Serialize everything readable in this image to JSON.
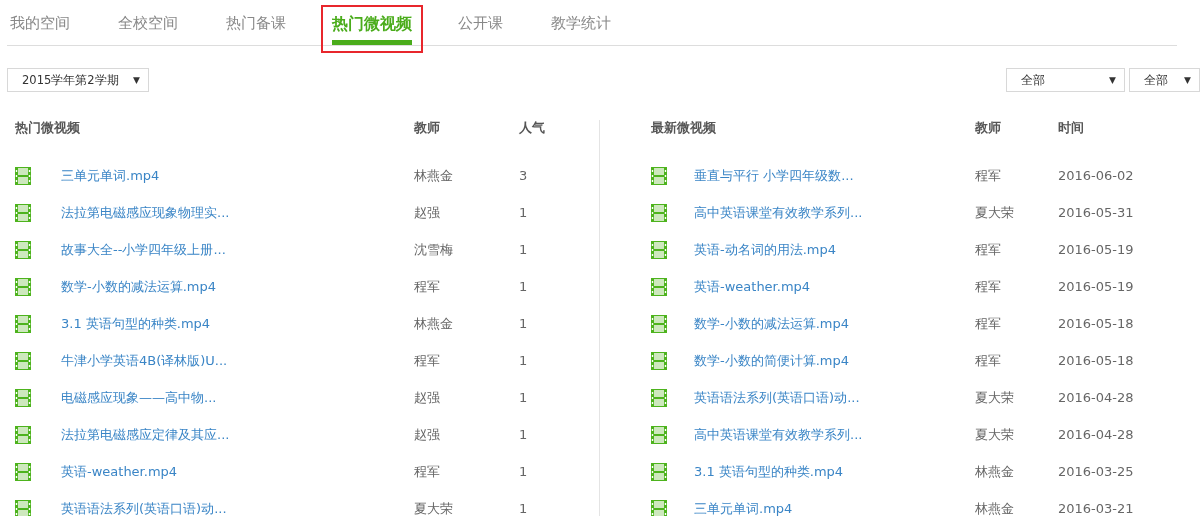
{
  "tabs": [
    {
      "label": "我的空间",
      "selected": false,
      "annotated": false
    },
    {
      "label": "全校空间",
      "selected": false,
      "annotated": false
    },
    {
      "label": "热门备课",
      "selected": false,
      "annotated": false
    },
    {
      "label": "热门微视频",
      "selected": true,
      "annotated": true
    },
    {
      "label": "公开课",
      "selected": false,
      "annotated": false
    },
    {
      "label": "教学统计",
      "selected": false,
      "annotated": false
    }
  ],
  "term_select": {
    "value": "2015学年第2学期",
    "arrow": "▼"
  },
  "filters": [
    {
      "value": "全部",
      "arrow": "▼"
    },
    {
      "value": "全部",
      "arrow": "▼"
    }
  ],
  "hot_table": {
    "columns": [
      "热门微视频",
      "教师",
      "人气"
    ],
    "rows": [
      {
        "title": "三单元单词.mp4",
        "teacher": "林燕金",
        "views": "3"
      },
      {
        "title": "法拉第电磁感应现象物理实...",
        "teacher": "赵强",
        "views": "1"
      },
      {
        "title": "故事大全--小学四年级上册...",
        "teacher": "沈雪梅",
        "views": "1"
      },
      {
        "title": "数学-小数的减法运算.mp4",
        "teacher": "程军",
        "views": "1"
      },
      {
        "title": "3.1 英语句型的种类.mp4",
        "teacher": "林燕金",
        "views": "1"
      },
      {
        "title": "牛津小学英语4B(译林版)U...",
        "teacher": "程军",
        "views": "1"
      },
      {
        "title": "电磁感应现象——高中物...",
        "teacher": "赵强",
        "views": "1"
      },
      {
        "title": "法拉第电磁感应定律及其应...",
        "teacher": "赵强",
        "views": "1"
      },
      {
        "title": "英语-weather.mp4",
        "teacher": "程军",
        "views": "1"
      },
      {
        "title": "英语语法系列(英语口语)动...",
        "teacher": "夏大荣",
        "views": "1"
      }
    ]
  },
  "new_table": {
    "columns": [
      "最新微视频",
      "教师",
      "时间"
    ],
    "rows": [
      {
        "title": "垂直与平行 小学四年级数...",
        "teacher": "程军",
        "date": "2016-06-02"
      },
      {
        "title": "高中英语课堂有效教学系列...",
        "teacher": "夏大荣",
        "date": "2016-05-31"
      },
      {
        "title": "英语-动名词的用法.mp4",
        "teacher": "程军",
        "date": "2016-05-19"
      },
      {
        "title": "英语-weather.mp4",
        "teacher": "程军",
        "date": "2016-05-19"
      },
      {
        "title": "数学-小数的减法运算.mp4",
        "teacher": "程军",
        "date": "2016-05-18"
      },
      {
        "title": "数学-小数的简便计算.mp4",
        "teacher": "程军",
        "date": "2016-05-18"
      },
      {
        "title": "英语语法系列(英语口语)动...",
        "teacher": "夏大荣",
        "date": "2016-04-28"
      },
      {
        "title": "高中英语课堂有效教学系列...",
        "teacher": "夏大荣",
        "date": "2016-04-28"
      },
      {
        "title": "3.1 英语句型的种类.mp4",
        "teacher": "林燕金",
        "date": "2016-03-25"
      },
      {
        "title": "三单元单词.mp4",
        "teacher": "林燕金",
        "date": "2016-03-21"
      }
    ]
  }
}
